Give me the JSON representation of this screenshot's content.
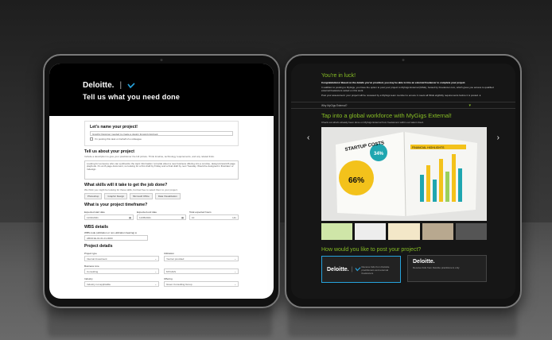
{
  "scene": {
    "wall_color": "#2a2a2a",
    "floor_color": "#5c5c5c",
    "accent_green": "#86bc25",
    "accent_blue": "#26a3dd"
  },
  "left": {
    "brand": "Deloitte.",
    "logo_icon": "mygigs-check-icon",
    "heading": "Tell us what you need done",
    "name_title": "Let's name your project!",
    "name_value": "Graphic Designer needed to create a design forward playbook",
    "posting_for_other": "I'm posting this task on behalf of a colleague",
    "about_title": "Tell us about your project",
    "about_desc": "Include a description to give your practitioner the full picture. Think timeline, technology requirements, and any related links.",
    "about_text": "Looking for someone who can synthesize the topic information I provide about a new business offering into a concise, design-forward 8-page playbook. It's an 8-page document, so looking for a first draft by Friday and a final draft by next Tuesday. Would be designed in Illustrator or Indesign.",
    "skills_title": "What skills will it take to get the job done?",
    "skills_desc": "We think you might be looking for these skills, but feel free to select them to your project.",
    "skills": [
      "Photoshop",
      "Graphic Design",
      "Microsoft Office",
      "Data Visualization"
    ],
    "timeframe_title": "What is your project timeframe?",
    "start_label": "Expected start date",
    "start_value": "11/01/2021",
    "end_label": "Expected end date",
    "end_value": "11/05/2021",
    "hours_label": "Total expected hours",
    "hours_value": "10",
    "hours_unit": "Hrs",
    "wbs_title": "WBS details",
    "wbs_label": "WBS code (utilization or non-utilization bearing)",
    "wbs_value": "ABCD1E-01-01-01-0000",
    "details_title": "Project details",
    "project_type_label": "Project type",
    "project_type_value": "Internal Investment",
    "utilization_label": "Utilization",
    "utilization_value": "Yes/not provided",
    "business_label": "Business Line",
    "business_value": "Consulting",
    "mygigs_label": "",
    "mygigs_value": "MYGIGS",
    "industry_label": "Industry",
    "industry_value": "Industry not applicable",
    "offering_label": "Offering",
    "offering_value": "Green Consulting Group"
  },
  "right": {
    "luck": "You're in luck!",
    "congrats": "Congratulations! Based on the details you've provided, you may be able to hire an external freelancer to complete your project.",
    "detail1": "In addition to posting to MyGigs, you have the option to post your project to MyGigs External (MGE), hosted by Freelancer.com, which gives you access to qualified external freelancers vetted on this work.",
    "detail2": "Post your assessment: your project will be reviewed by a MyGigs team member to ensure it meets all MGE eligibility requirements before it is posted.",
    "why": "Why MyGigs External?",
    "tap": "Tap into a global workforce with MyGigs External!",
    "check": "Check out what's already been done on MyGigs External from freelancers within our talent cloud.",
    "startup_text": "STARTUP COSTS",
    "pct_big": "66%",
    "pct_small": "34%",
    "fin_label": "FINANCIAL HIGHLIGHTS",
    "post_q": "How would you like to post your project?",
    "card1_brand": "Deloitte.",
    "card1_text": "Receive bids from Deloitte practitioners and external freelancers",
    "card2_brand": "Deloitte.",
    "card2_text": "Receive bids from Deloitte practitioners only"
  }
}
